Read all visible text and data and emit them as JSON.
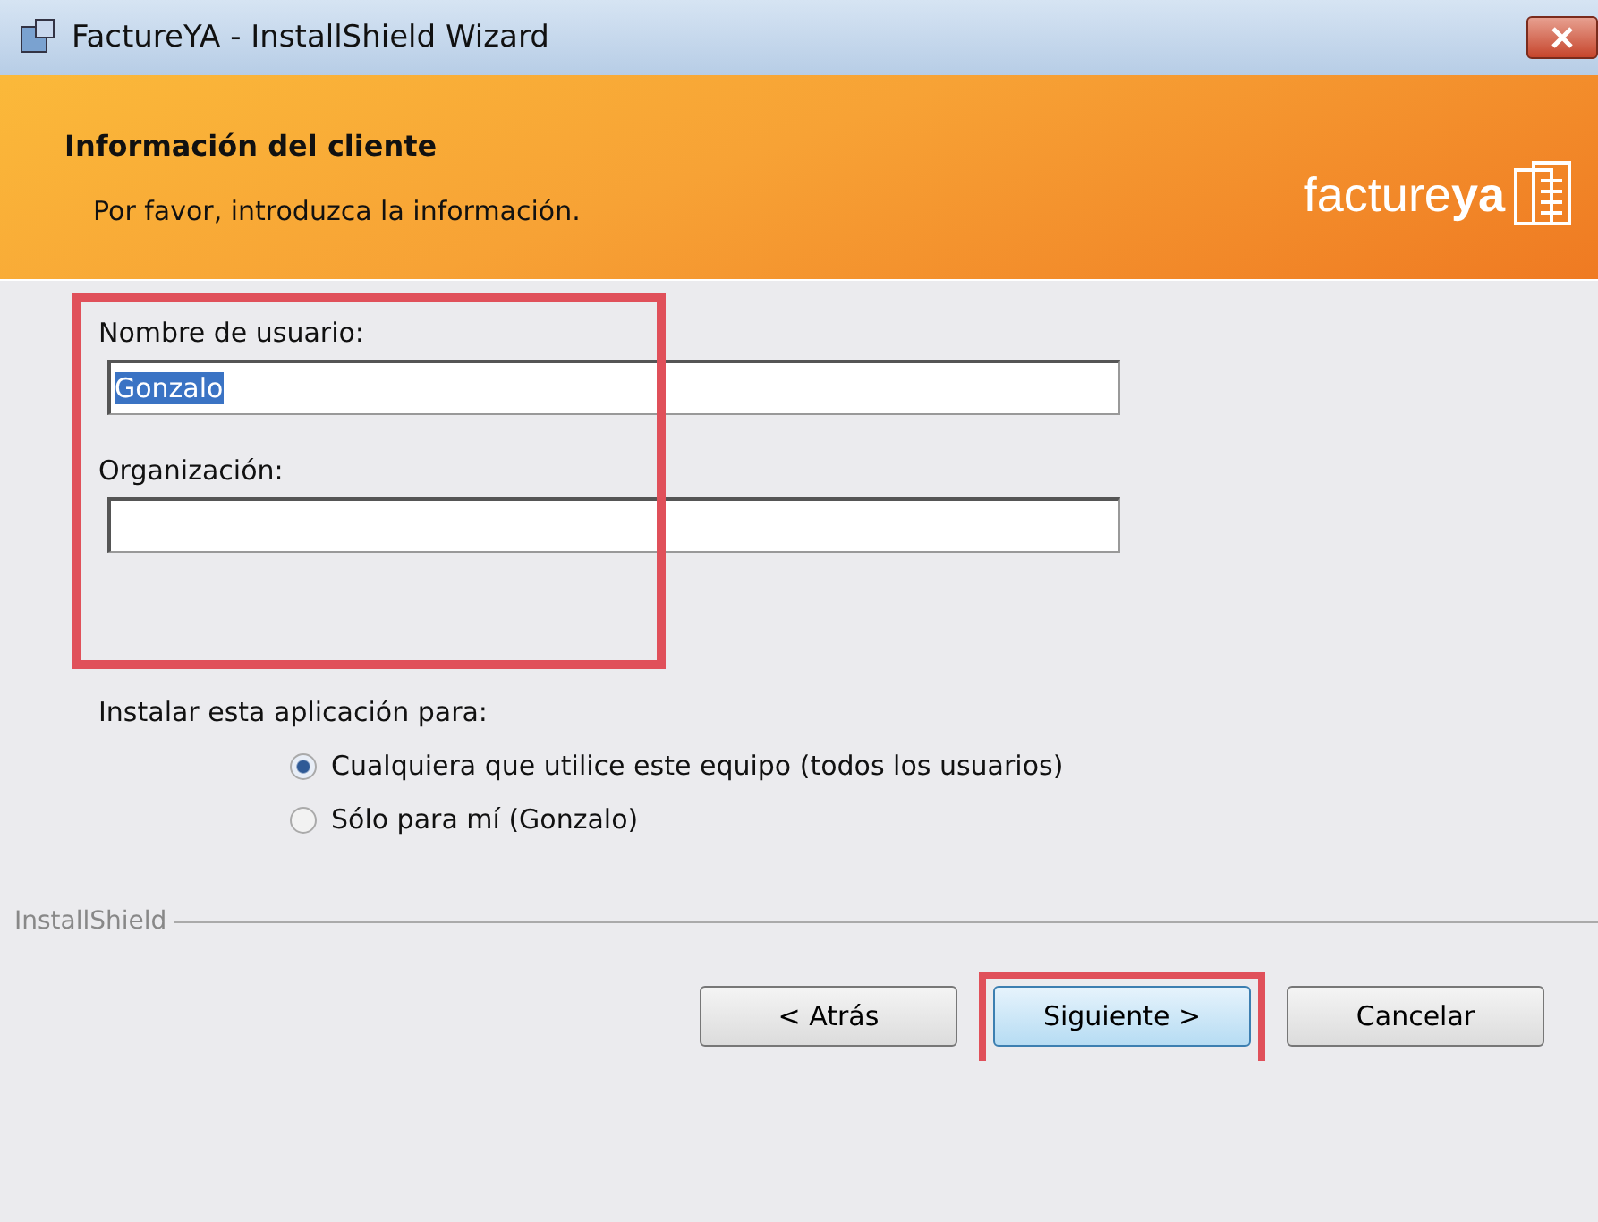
{
  "window": {
    "title": "FactureYA - InstallShield Wizard"
  },
  "header": {
    "title": "Información del cliente",
    "subtitle": "Por favor, introduzca la información.",
    "logo_regular": "facture",
    "logo_bold": "ya"
  },
  "fields": [
    {
      "label": "Nombre de usuario:",
      "value": "Gonzalo",
      "text_selected": true
    },
    {
      "label": "Organización:"
    }
  ],
  "install_for": {
    "label": "Instalar esta aplicación para:",
    "options": [
      {
        "label": "Cualquiera que utilice este equipo (todos los usuarios)",
        "selected": true
      },
      {
        "label": "Sólo para mí (Gonzalo)",
        "selected": false
      }
    ]
  },
  "footer": {
    "brand": "InstallShield"
  },
  "buttons": [
    {
      "label": "< Atrás",
      "highlighted": false
    },
    {
      "label": "Siguiente >",
      "highlighted": true
    },
    {
      "label": "Cancelar",
      "highlighted": false
    }
  ]
}
